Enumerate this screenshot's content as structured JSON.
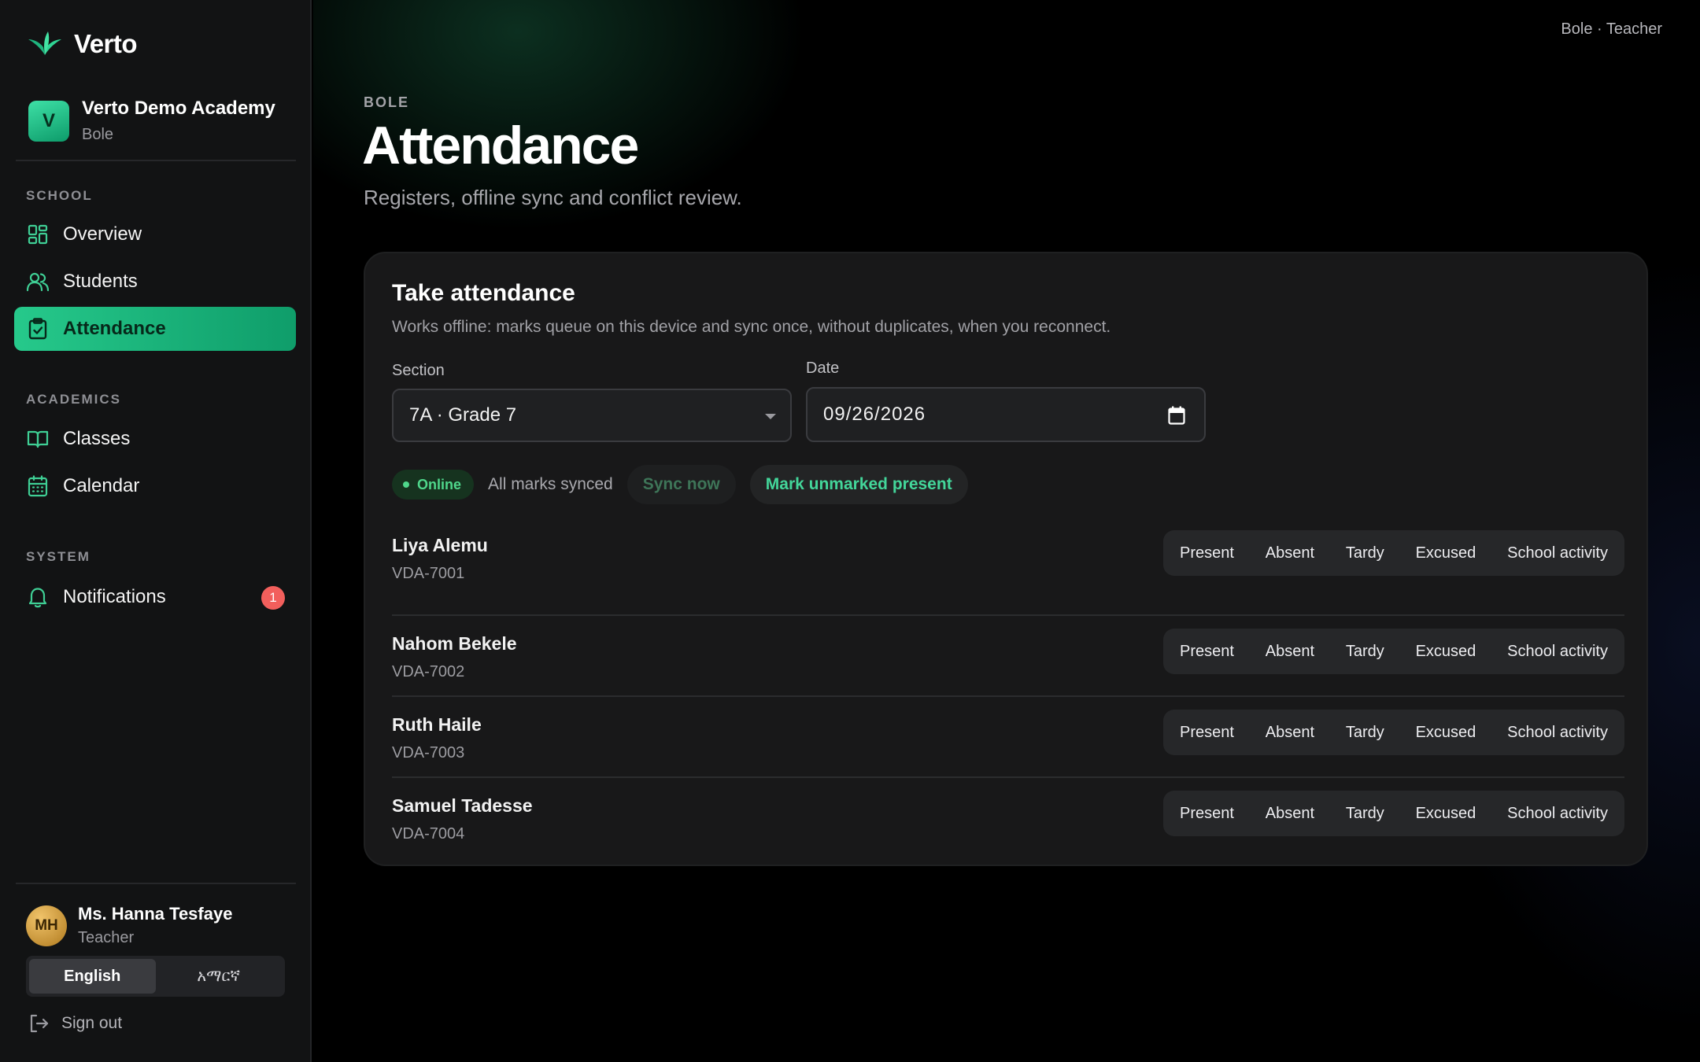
{
  "brand": {
    "name": "Verto"
  },
  "school": {
    "initial": "V",
    "name": "Verto Demo Academy",
    "campus": "Bole"
  },
  "nav": {
    "school_heading": "SCHOOL",
    "academics_heading": "ACADEMICS",
    "system_heading": "SYSTEM",
    "overview": "Overview",
    "students": "Students",
    "attendance": "Attendance",
    "classes": "Classes",
    "calendar": "Calendar",
    "notifications": "Notifications",
    "notifications_count": "1"
  },
  "user": {
    "initials": "MH",
    "name": "Ms. Hanna Tesfaye",
    "role": "Teacher"
  },
  "language": {
    "english": "English",
    "amharic": "አማርኛ",
    "selected": "English"
  },
  "signout": "Sign out",
  "topbar": {
    "user": "Bole · Teacher"
  },
  "page": {
    "eyebrow": "BOLE",
    "title": "Attendance",
    "subtitle": "Registers, offline sync and conflict review."
  },
  "card": {
    "title": "Take attendance",
    "subtitle": "Works offline: marks queue on this device and sync once, without duplicates, when you reconnect.",
    "section_label": "Section",
    "section_value": "7A · Grade 7",
    "date_label": "Date",
    "date_value": "09/26/2026",
    "status": "Online",
    "sync_status": "All marks synced",
    "sync_button": "Sync now",
    "mark_button": "Mark unmarked present"
  },
  "statuses": [
    "Present",
    "Absent",
    "Tardy",
    "Excused",
    "School activity"
  ],
  "students": [
    {
      "name": "Liya Alemu",
      "id": "VDA-7001"
    },
    {
      "name": "Nahom Bekele",
      "id": "VDA-7002"
    },
    {
      "name": "Ruth Haile",
      "id": "VDA-7003"
    },
    {
      "name": "Samuel Tadesse",
      "id": "VDA-7004"
    }
  ],
  "colors": {
    "accent": "#26c98b",
    "accent_text": "#43d69a",
    "online": "#4fd78b",
    "badge": "#f25f5c",
    "sidebar_bg": "#121314",
    "card_bg": "#181819"
  }
}
